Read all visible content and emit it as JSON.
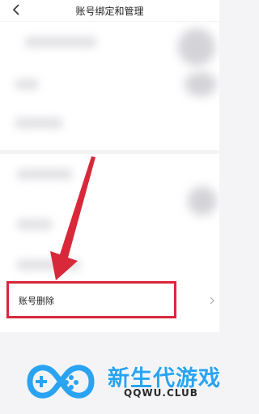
{
  "header": {
    "title": "账号绑定和管理",
    "back_icon": "chevron-left-icon"
  },
  "account_delete_item": {
    "label": "账号删除",
    "chevron_icon": "chevron-right-icon"
  },
  "annotation": {
    "arrow_color": "#d8283a",
    "highlight_color": "#d8283a"
  },
  "watermark": {
    "name": "新生代游戏",
    "url": "QQWU.CLUB",
    "brand_color": "#29a3f2"
  }
}
